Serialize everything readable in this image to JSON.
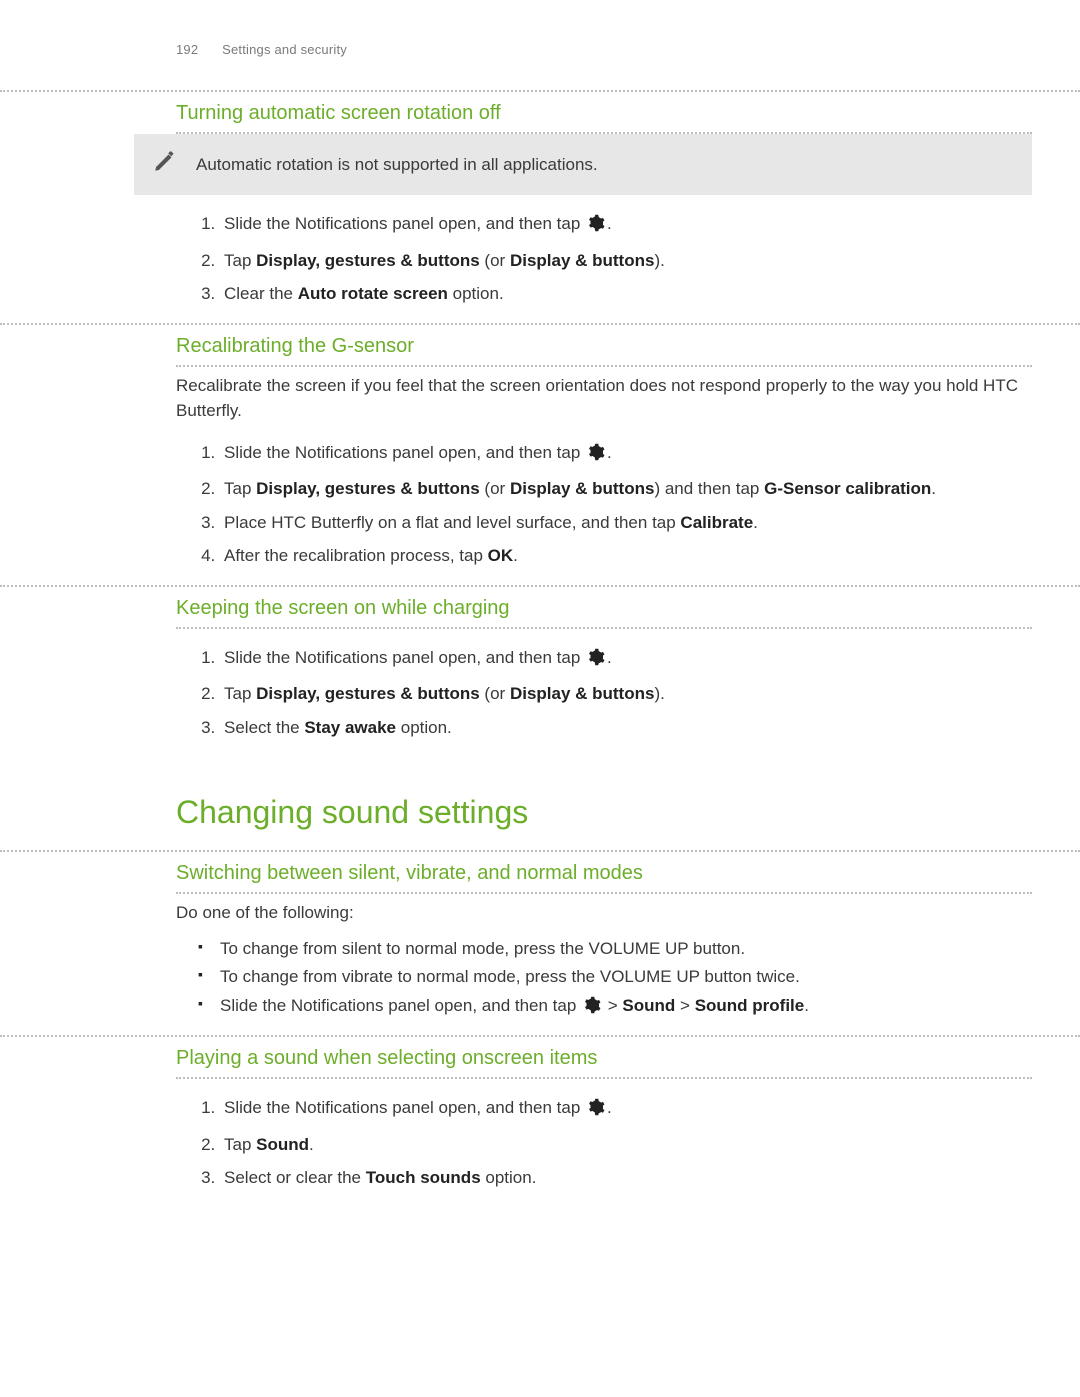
{
  "header": {
    "pageNum": "192",
    "section": "Settings and security"
  },
  "sec1": {
    "title": "Turning automatic screen rotation off",
    "note": "Automatic rotation is not supported in all applications.",
    "step1_a": "Slide the Notifications panel open, and then tap ",
    "step1_b": ".",
    "step2_a": "Tap ",
    "step2_b": "Display, gestures & buttons",
    "step2_c": " (or ",
    "step2_d": "Display & buttons",
    "step2_e": ").",
    "step3_a": "Clear the ",
    "step3_b": "Auto rotate screen",
    "step3_c": " option."
  },
  "sec2": {
    "title": "Recalibrating the G-sensor",
    "intro": "Recalibrate the screen if you feel that the screen orientation does not respond properly to the way you hold HTC Butterfly.",
    "step1_a": "Slide the Notifications panel open, and then tap ",
    "step1_b": ".",
    "step2_a": "Tap ",
    "step2_b": "Display, gestures & buttons",
    "step2_c": " (or ",
    "step2_d": "Display & buttons",
    "step2_e": ") and then tap ",
    "step2_f": "G-Sensor calibration",
    "step2_g": ".",
    "step3_a": "Place HTC Butterfly on a flat and level surface, and then tap ",
    "step3_b": "Calibrate",
    "step3_c": ".",
    "step4_a": "After the recalibration process, tap ",
    "step4_b": "OK",
    "step4_c": "."
  },
  "sec3": {
    "title": "Keeping the screen on while charging",
    "step1_a": "Slide the Notifications panel open, and then tap ",
    "step1_b": ".",
    "step2_a": "Tap ",
    "step2_b": "Display, gestures & buttons",
    "step2_c": " (or ",
    "step2_d": "Display & buttons",
    "step2_e": ").",
    "step3_a": "Select the ",
    "step3_b": "Stay awake",
    "step3_c": " option."
  },
  "bigTitle": "Changing sound settings",
  "sec4": {
    "title": "Switching between silent, vibrate, and normal modes",
    "intro": "Do one of the following:",
    "b1": "To change from silent to normal mode, press the VOLUME UP button.",
    "b2": "To change from vibrate to normal mode, press the VOLUME UP button twice.",
    "b3_a": "Slide the Notifications panel open, and then tap ",
    "b3_b": " > ",
    "b3_c": "Sound",
    "b3_d": " > ",
    "b3_e": "Sound profile",
    "b3_f": "."
  },
  "sec5": {
    "title": "Playing a sound when selecting onscreen items",
    "step1_a": "Slide the Notifications panel open, and then tap ",
    "step1_b": ".",
    "step2_a": "Tap ",
    "step2_b": "Sound",
    "step2_c": ".",
    "step3_a": "Select or clear the ",
    "step3_b": "Touch sounds",
    "step3_c": " option."
  }
}
